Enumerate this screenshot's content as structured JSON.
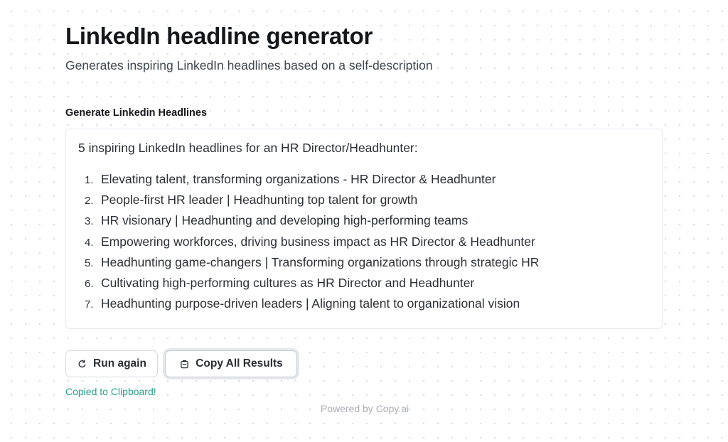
{
  "header": {
    "title": "LinkedIn headline generator",
    "subtitle": "Generates inspiring LinkedIn headlines based on a self-description"
  },
  "section": {
    "label": "Generate Linkedin Headlines"
  },
  "result": {
    "intro": "5 inspiring LinkedIn headlines for an HR Director/Headhunter:",
    "items": [
      {
        "num": "1.",
        "text": "Elevating talent, transforming organizations - HR Director & Headhunter"
      },
      {
        "num": "2.",
        "text": "People-first HR leader | Headhunting top talent for growth"
      },
      {
        "num": "3.",
        "text": "HR visionary | Headhunting and developing high-performing teams"
      },
      {
        "num": "4.",
        "text": "Empowering workforces, driving business impact as HR Director & Headhunter"
      },
      {
        "num": "5.",
        "text": "Headhunting game-changers | Transforming organizations through strategic HR"
      },
      {
        "num": "6.",
        "text": "Cultivating high-performing cultures as HR Director and Headhunter"
      },
      {
        "num": "7.",
        "text": "Headhunting purpose-driven leaders | Aligning talent to organizational vision"
      }
    ]
  },
  "actions": {
    "run_again_label": "Run again",
    "run_again_icon": "refresh-icon",
    "copy_all_label": "Copy All Results",
    "copy_all_icon": "clipboard-icon"
  },
  "status": {
    "copied_message": "Copied to Clipboard!",
    "copied_color": "#2aa08a"
  },
  "footer": {
    "powered_by": "Powered by Copy.ai"
  }
}
